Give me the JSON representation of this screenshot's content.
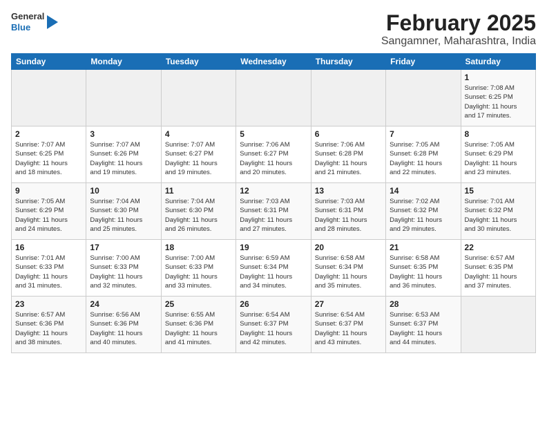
{
  "header": {
    "logo_line1": "General",
    "logo_line2": "Blue",
    "title": "February 2025",
    "subtitle": "Sangamner, Maharashtra, India"
  },
  "weekdays": [
    "Sunday",
    "Monday",
    "Tuesday",
    "Wednesday",
    "Thursday",
    "Friday",
    "Saturday"
  ],
  "weeks": [
    [
      {
        "day": "",
        "info": ""
      },
      {
        "day": "",
        "info": ""
      },
      {
        "day": "",
        "info": ""
      },
      {
        "day": "",
        "info": ""
      },
      {
        "day": "",
        "info": ""
      },
      {
        "day": "",
        "info": ""
      },
      {
        "day": "1",
        "info": "Sunrise: 7:08 AM\nSunset: 6:25 PM\nDaylight: 11 hours\nand 17 minutes."
      }
    ],
    [
      {
        "day": "2",
        "info": "Sunrise: 7:07 AM\nSunset: 6:25 PM\nDaylight: 11 hours\nand 18 minutes."
      },
      {
        "day": "3",
        "info": "Sunrise: 7:07 AM\nSunset: 6:26 PM\nDaylight: 11 hours\nand 19 minutes."
      },
      {
        "day": "4",
        "info": "Sunrise: 7:07 AM\nSunset: 6:27 PM\nDaylight: 11 hours\nand 19 minutes."
      },
      {
        "day": "5",
        "info": "Sunrise: 7:06 AM\nSunset: 6:27 PM\nDaylight: 11 hours\nand 20 minutes."
      },
      {
        "day": "6",
        "info": "Sunrise: 7:06 AM\nSunset: 6:28 PM\nDaylight: 11 hours\nand 21 minutes."
      },
      {
        "day": "7",
        "info": "Sunrise: 7:05 AM\nSunset: 6:28 PM\nDaylight: 11 hours\nand 22 minutes."
      },
      {
        "day": "8",
        "info": "Sunrise: 7:05 AM\nSunset: 6:29 PM\nDaylight: 11 hours\nand 23 minutes."
      }
    ],
    [
      {
        "day": "9",
        "info": "Sunrise: 7:05 AM\nSunset: 6:29 PM\nDaylight: 11 hours\nand 24 minutes."
      },
      {
        "day": "10",
        "info": "Sunrise: 7:04 AM\nSunset: 6:30 PM\nDaylight: 11 hours\nand 25 minutes."
      },
      {
        "day": "11",
        "info": "Sunrise: 7:04 AM\nSunset: 6:30 PM\nDaylight: 11 hours\nand 26 minutes."
      },
      {
        "day": "12",
        "info": "Sunrise: 7:03 AM\nSunset: 6:31 PM\nDaylight: 11 hours\nand 27 minutes."
      },
      {
        "day": "13",
        "info": "Sunrise: 7:03 AM\nSunset: 6:31 PM\nDaylight: 11 hours\nand 28 minutes."
      },
      {
        "day": "14",
        "info": "Sunrise: 7:02 AM\nSunset: 6:32 PM\nDaylight: 11 hours\nand 29 minutes."
      },
      {
        "day": "15",
        "info": "Sunrise: 7:01 AM\nSunset: 6:32 PM\nDaylight: 11 hours\nand 30 minutes."
      }
    ],
    [
      {
        "day": "16",
        "info": "Sunrise: 7:01 AM\nSunset: 6:33 PM\nDaylight: 11 hours\nand 31 minutes."
      },
      {
        "day": "17",
        "info": "Sunrise: 7:00 AM\nSunset: 6:33 PM\nDaylight: 11 hours\nand 32 minutes."
      },
      {
        "day": "18",
        "info": "Sunrise: 7:00 AM\nSunset: 6:33 PM\nDaylight: 11 hours\nand 33 minutes."
      },
      {
        "day": "19",
        "info": "Sunrise: 6:59 AM\nSunset: 6:34 PM\nDaylight: 11 hours\nand 34 minutes."
      },
      {
        "day": "20",
        "info": "Sunrise: 6:58 AM\nSunset: 6:34 PM\nDaylight: 11 hours\nand 35 minutes."
      },
      {
        "day": "21",
        "info": "Sunrise: 6:58 AM\nSunset: 6:35 PM\nDaylight: 11 hours\nand 36 minutes."
      },
      {
        "day": "22",
        "info": "Sunrise: 6:57 AM\nSunset: 6:35 PM\nDaylight: 11 hours\nand 37 minutes."
      }
    ],
    [
      {
        "day": "23",
        "info": "Sunrise: 6:57 AM\nSunset: 6:36 PM\nDaylight: 11 hours\nand 38 minutes."
      },
      {
        "day": "24",
        "info": "Sunrise: 6:56 AM\nSunset: 6:36 PM\nDaylight: 11 hours\nand 40 minutes."
      },
      {
        "day": "25",
        "info": "Sunrise: 6:55 AM\nSunset: 6:36 PM\nDaylight: 11 hours\nand 41 minutes."
      },
      {
        "day": "26",
        "info": "Sunrise: 6:54 AM\nSunset: 6:37 PM\nDaylight: 11 hours\nand 42 minutes."
      },
      {
        "day": "27",
        "info": "Sunrise: 6:54 AM\nSunset: 6:37 PM\nDaylight: 11 hours\nand 43 minutes."
      },
      {
        "day": "28",
        "info": "Sunrise: 6:53 AM\nSunset: 6:37 PM\nDaylight: 11 hours\nand 44 minutes."
      },
      {
        "day": "",
        "info": ""
      }
    ]
  ]
}
